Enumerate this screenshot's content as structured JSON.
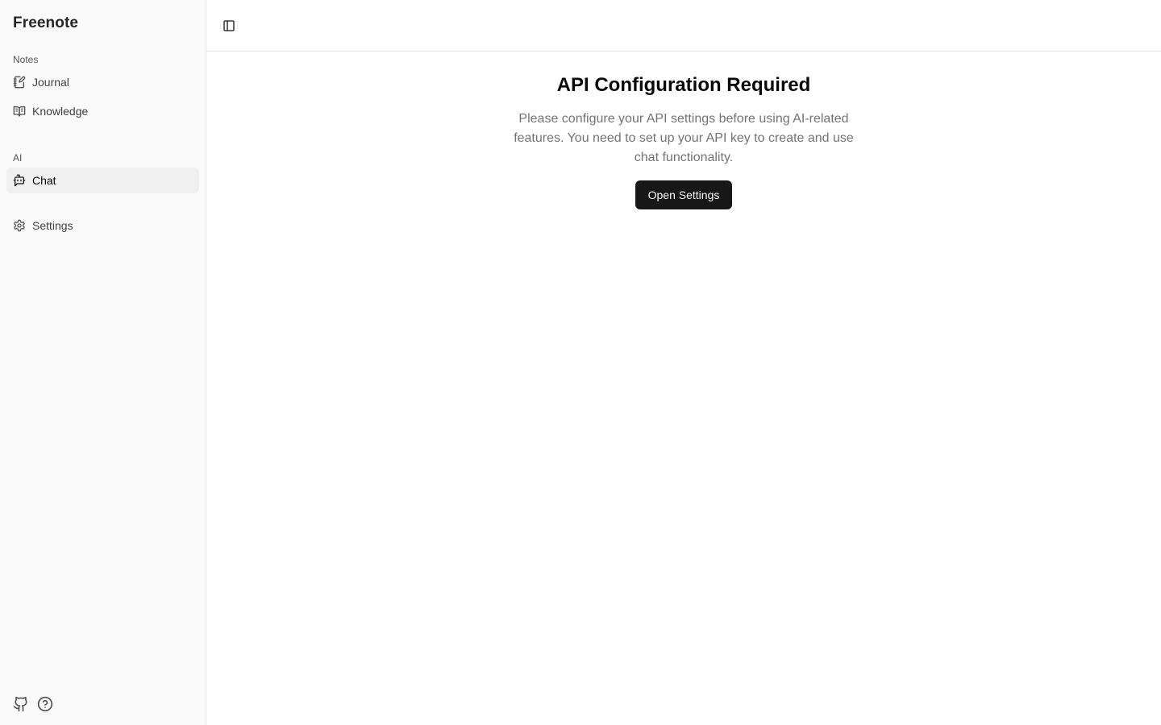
{
  "app": {
    "brand": "Freenote"
  },
  "sidebar": {
    "groups": [
      {
        "label": "Notes",
        "items": [
          {
            "label": "Journal",
            "icon": "notebook-pen-icon"
          },
          {
            "label": "Knowledge",
            "icon": "book-open-icon"
          }
        ]
      },
      {
        "label": "AI",
        "items": [
          {
            "label": "Chat",
            "icon": "bot-message-icon",
            "active": true
          }
        ]
      }
    ],
    "settings": {
      "label": "Settings",
      "icon": "gear-icon"
    },
    "footer": [
      {
        "icon": "github-icon"
      },
      {
        "icon": "help-circle-icon"
      }
    ]
  },
  "topbar": {
    "toggle_icon": "panel-left-icon"
  },
  "main": {
    "title": "API Configuration Required",
    "description": "Please configure your API settings before using AI-related features. You need to set up your API key to create and use chat functionality.",
    "button_label": "Open Settings"
  },
  "colors": {
    "sidebar_bg": "#fafafa",
    "active_item_bg": "#f0f0f0",
    "primary_button": "#171717",
    "border": "#e5e5e5",
    "muted_text": "#737373"
  }
}
